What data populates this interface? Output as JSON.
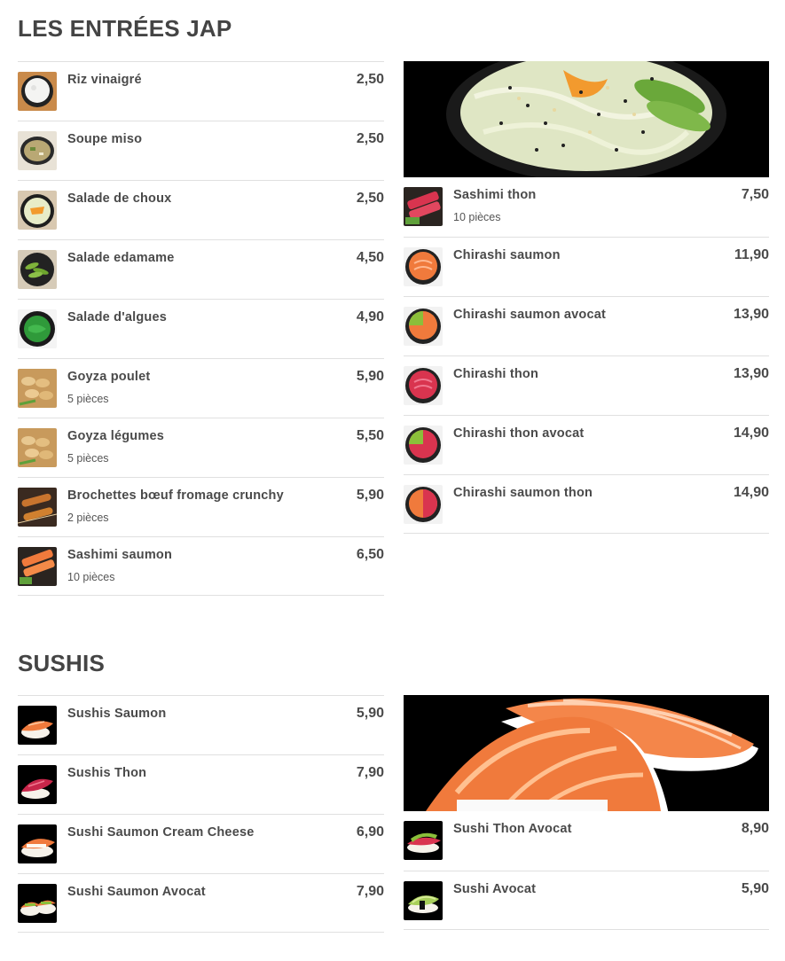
{
  "entrees": {
    "title": "LES ENTRÉES JAP",
    "left_items": [
      {
        "name": "Riz vinaigré",
        "desc": "",
        "price": "2,50",
        "icon": "rice-bowl-icon"
      },
      {
        "name": "Soupe miso",
        "desc": "",
        "price": "2,50",
        "icon": "miso-soup-icon"
      },
      {
        "name": "Salade de choux",
        "desc": "",
        "price": "2,50",
        "icon": "cabbage-salad-icon"
      },
      {
        "name": "Salade edamame",
        "desc": "",
        "price": "4,50",
        "icon": "edamame-icon"
      },
      {
        "name": "Salade d'algues",
        "desc": "",
        "price": "4,90",
        "icon": "seaweed-salad-icon"
      },
      {
        "name": "Goyza poulet",
        "desc": "5 pièces",
        "price": "5,90",
        "icon": "gyoza-icon"
      },
      {
        "name": "Goyza légumes",
        "desc": "5 pièces",
        "price": "5,50",
        "icon": "gyoza-icon"
      },
      {
        "name": "Brochettes bœuf fromage crunchy",
        "desc": "2 pièces",
        "price": "5,90",
        "icon": "skewer-icon"
      },
      {
        "name": "Sashimi saumon",
        "desc": "10 pièces",
        "price": "6,50",
        "icon": "salmon-sashimi-icon"
      }
    ],
    "right_items": [
      {
        "name": "Sashimi thon",
        "desc": "10 pièces",
        "price": "7,50",
        "icon": "tuna-sashimi-icon"
      },
      {
        "name": "Chirashi saumon",
        "desc": "",
        "price": "11,90",
        "icon": "salmon-chirashi-icon"
      },
      {
        "name": "Chirashi saumon avocat",
        "desc": "",
        "price": "13,90",
        "icon": "salmon-avocado-chirashi-icon"
      },
      {
        "name": "Chirashi thon",
        "desc": "",
        "price": "13,90",
        "icon": "tuna-chirashi-icon"
      },
      {
        "name": "Chirashi thon avocat",
        "desc": "",
        "price": "14,90",
        "icon": "tuna-avocado-chirashi-icon"
      },
      {
        "name": "Chirashi saumon thon",
        "desc": "",
        "price": "14,90",
        "icon": "salmon-tuna-chirashi-icon"
      }
    ]
  },
  "sushis": {
    "title": "SUSHIS",
    "left_items": [
      {
        "name": "Sushis Saumon",
        "desc": "",
        "price": "5,90",
        "icon": "salmon-sushi-icon"
      },
      {
        "name": "Sushis Thon",
        "desc": "",
        "price": "7,90",
        "icon": "tuna-sushi-icon"
      },
      {
        "name": "Sushi Saumon Cream Cheese",
        "desc": "",
        "price": "6,90",
        "icon": "salmon-cheese-sushi-icon"
      },
      {
        "name": "Sushi Saumon Avocat",
        "desc": "",
        "price": "7,90",
        "icon": "salmon-avocado-sushi-icon"
      }
    ],
    "right_items": [
      {
        "name": "Sushi Thon Avocat",
        "desc": "",
        "price": "8,90",
        "icon": "tuna-avocado-sushi-icon"
      },
      {
        "name": "Sushi Avocat",
        "desc": "",
        "price": "5,90",
        "icon": "avocado-sushi-icon"
      }
    ]
  },
  "colors": {
    "text": "#444444",
    "divider": "#e0e0e0",
    "salmon": "#f07a3c",
    "tuna": "#d9344f",
    "avocado": "#8bbf3a"
  }
}
